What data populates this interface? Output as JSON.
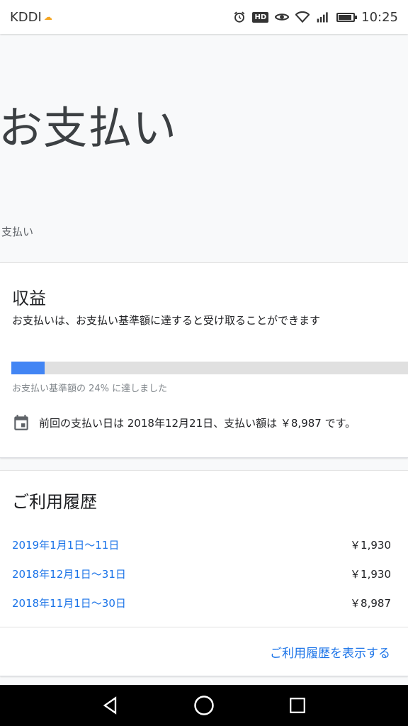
{
  "status_bar": {
    "carrier": "KDDI",
    "time": "10:25",
    "hd_label": "HD"
  },
  "page": {
    "title": "お支払い",
    "breadcrumb": "支払い"
  },
  "earnings": {
    "title": "収益",
    "description": "お支払いは、お支払い基準額に達すると受け取ることができます",
    "progress_fraction": 0.24,
    "progress_label": "お支払い基準額の 24% に達しました",
    "last_payment_text": "前回の支払い日は 2018年12月21日、支払い額は ￥8,987 です。",
    "progress_color": "#4285f4"
  },
  "history": {
    "title": "ご利用履歴",
    "rows": [
      {
        "period": "2019年1月1日〜11日",
        "amount": "￥1,930"
      },
      {
        "period": "2018年12月1日〜31日",
        "amount": "￥1,930"
      },
      {
        "period": "2018年11月1日〜30日",
        "amount": "￥8,987"
      }
    ],
    "view_all": "ご利用履歴を表示する",
    "link_color": "#1a73e8"
  },
  "icons": {
    "status": [
      "alarm-icon",
      "eye-icon",
      "wifi-icon",
      "signal-icon",
      "battery-icon"
    ],
    "card": [
      "calendar-icon"
    ],
    "nav": [
      "back-icon",
      "home-icon",
      "recents-icon"
    ]
  }
}
